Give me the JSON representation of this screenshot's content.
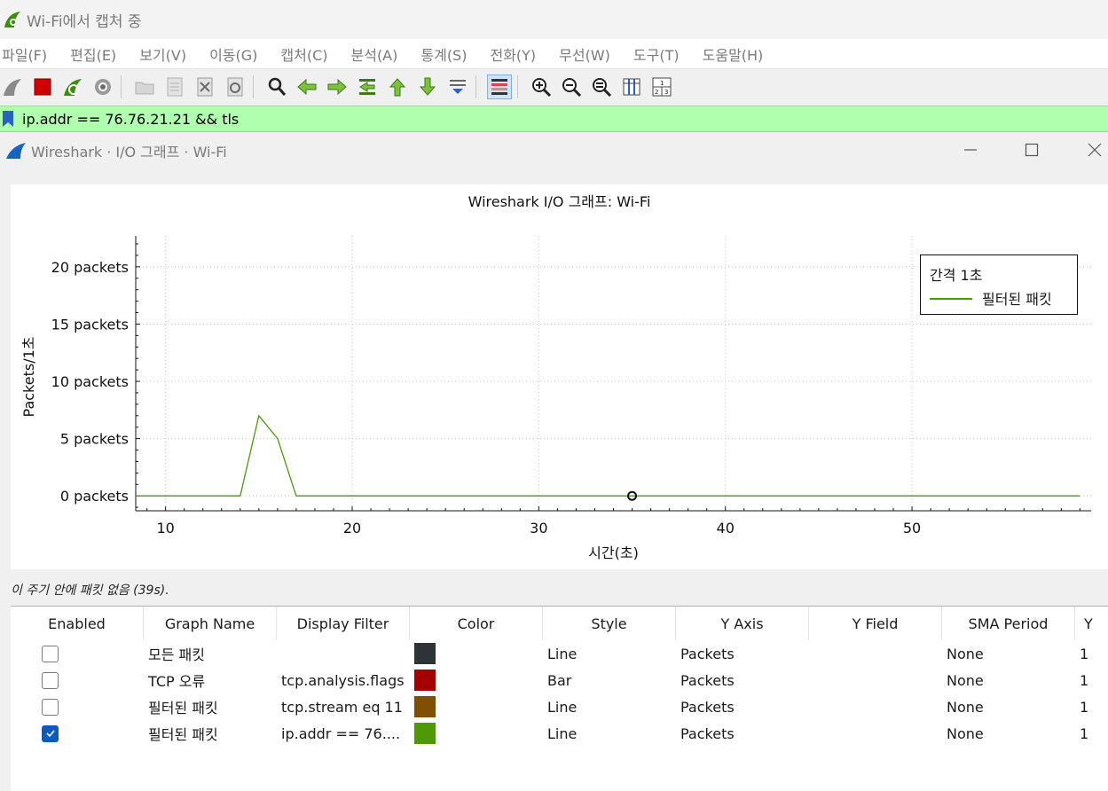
{
  "main_window": {
    "title": "Wi-Fi에서 캡처 중"
  },
  "menu": [
    "파일(F)",
    "편집(E)",
    "보기(V)",
    "이동(G)",
    "캡처(C)",
    "분석(A)",
    "통계(S)",
    "전화(Y)",
    "무선(W)",
    "도구(T)",
    "도움말(H)"
  ],
  "toolbar": {
    "icons": [
      "shark-fin-icon",
      "stop-capture-icon",
      "restart-capture-icon",
      "capture-options-icon",
      "open-file-icon",
      "save-file-icon",
      "close-file-icon",
      "reload-file-icon",
      "find-packet-icon",
      "go-back-icon",
      "go-forward-icon",
      "go-to-packet-icon",
      "go-first-icon",
      "go-last-icon",
      "autoscroll-icon",
      "colorize-icon",
      "zoom-in-icon",
      "zoom-out-icon",
      "zoom-normal-icon",
      "resize-columns-icon",
      "layout-icon"
    ]
  },
  "filter": {
    "value": "ip.addr == 76.76.21.21 && tls"
  },
  "dialog": {
    "title": "Wireshark · I/O 그래프 · Wi-Fi"
  },
  "chart_data": {
    "type": "line",
    "title": "Wireshark I/O 그래프: Wi-Fi",
    "xlabel": "시간(초)",
    "ylabel": "Packets/1초",
    "xlim": [
      8.4,
      59.6
    ],
    "ylim": [
      -1.3,
      22.7
    ],
    "x_ticks": [
      10,
      20,
      30,
      40,
      50
    ],
    "x_tick_labels": [
      "10",
      "20",
      "30",
      "40",
      "50"
    ],
    "y_ticks": [
      0,
      5,
      10,
      15,
      20
    ],
    "y_tick_labels": [
      "0 packets",
      "5 packets",
      "10 packets",
      "15 packets",
      "20 packets"
    ],
    "grid": true,
    "legend": {
      "title": "간격 1초",
      "placement": "top-right"
    },
    "series": [
      {
        "name": "필터된 패킷",
        "color": "#4b9a0b",
        "x": [
          8,
          9,
          10,
          11,
          12,
          13,
          14,
          15,
          16,
          17,
          18,
          19,
          20,
          25,
          30,
          35,
          40,
          45,
          50,
          55,
          59
        ],
        "values": [
          0,
          0,
          0,
          0,
          0,
          0,
          0,
          7,
          5,
          0,
          0,
          0,
          0,
          0,
          0,
          0,
          0,
          0,
          0,
          0,
          0
        ]
      }
    ],
    "marker": {
      "x": 35,
      "y": 0
    }
  },
  "status": "이 주기 안에 패킷 없음 (39s).",
  "table": {
    "columns": [
      "Enabled",
      "Graph Name",
      "Display Filter",
      "Color",
      "Style",
      "Y Axis",
      "Y Field",
      "SMA Period",
      "Y"
    ],
    "rows": [
      {
        "enabled": false,
        "name": "모든 패킷",
        "filter": "",
        "color": "#2e3436",
        "style": "Line",
        "y_axis": "Packets",
        "y_field": "",
        "sma": "None",
        "y": "1"
      },
      {
        "enabled": false,
        "name": "TCP 오류",
        "filter": "tcp.analysis.flags",
        "color": "#a40000",
        "style": "Bar",
        "y_axis": "Packets",
        "y_field": "",
        "sma": "None",
        "y": "1"
      },
      {
        "enabled": false,
        "name": "필터된 패킷",
        "filter": "tcp.stream eq 11",
        "color": "#7f4f00",
        "style": "Line",
        "y_axis": "Packets",
        "y_field": "",
        "sma": "None",
        "y": "1"
      },
      {
        "enabled": true,
        "name": "필터된 패킷",
        "filter": "ip.addr == 76....",
        "color": "#4e9a06",
        "style": "Line",
        "y_axis": "Packets",
        "y_field": "",
        "sma": "None",
        "y": "1"
      }
    ]
  }
}
